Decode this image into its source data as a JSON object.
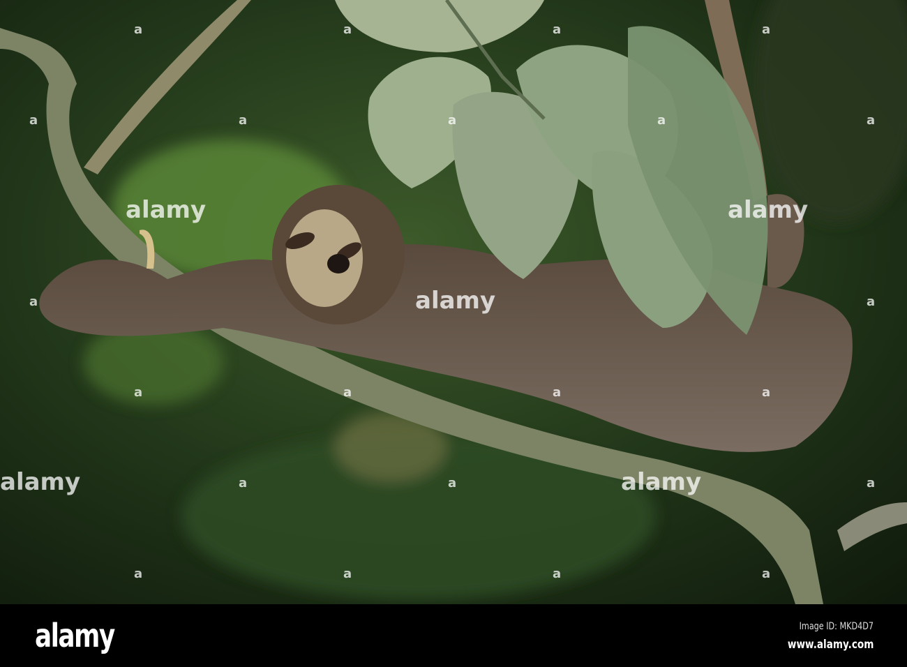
{
  "photo": {
    "subject": "sloth sleeping on branch",
    "watermark_text": "alamy",
    "watermark_mark": "a"
  },
  "footer": {
    "logo": "alamy",
    "image_id": "Image ID: MKD4D7",
    "url": "www.alamy.com"
  }
}
